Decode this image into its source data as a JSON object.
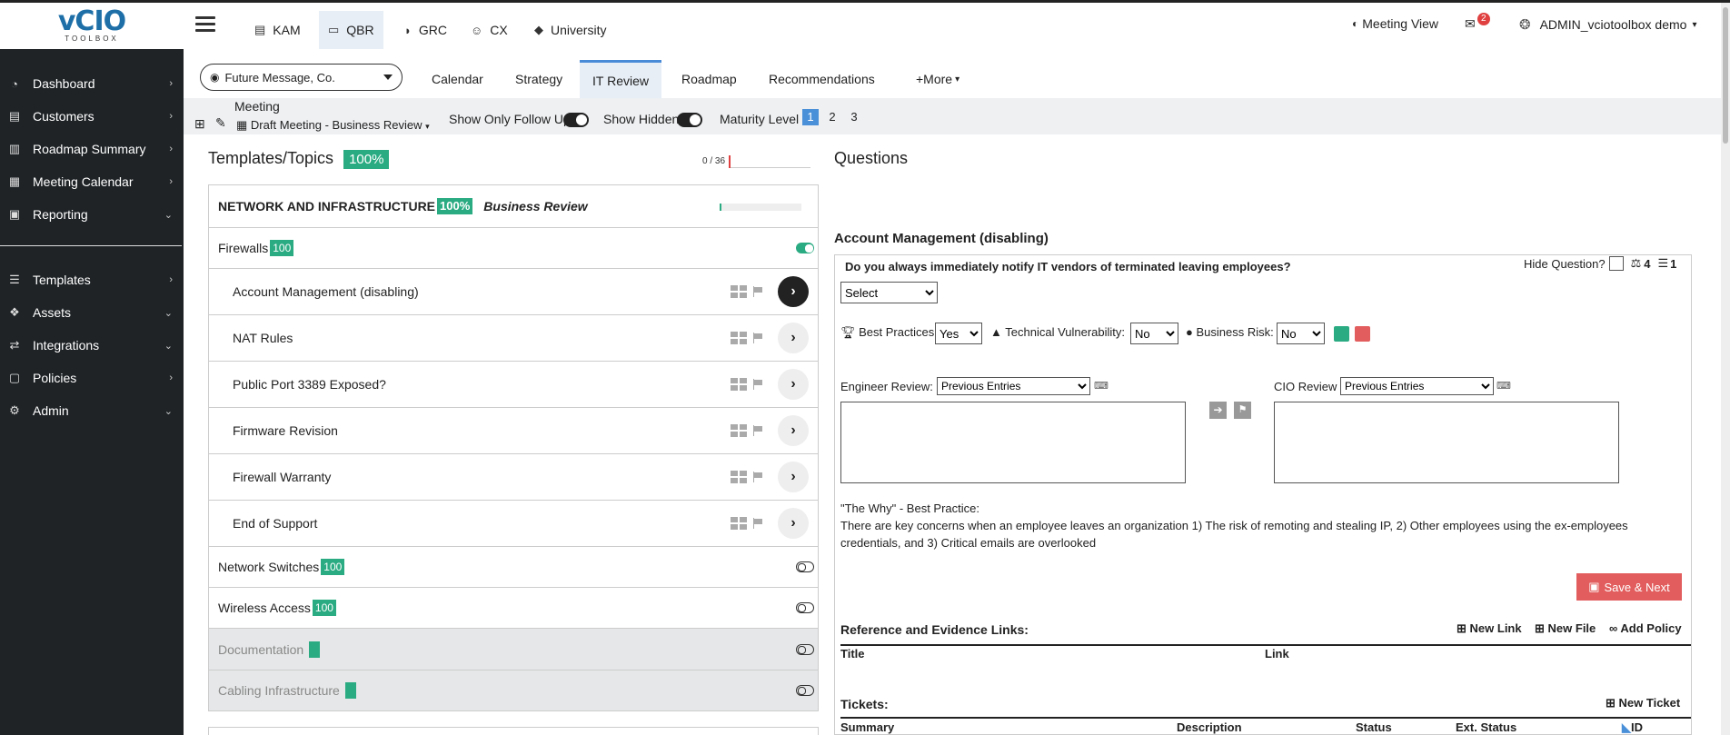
{
  "logo": {
    "main": "vCIO",
    "sub": "TOOLBOX"
  },
  "sidebar": {
    "items": [
      {
        "label": "Dashboard",
        "icon": "gauge-icon",
        "chevron": "›"
      },
      {
        "label": "Customers",
        "icon": "id-card-icon",
        "chevron": "›"
      },
      {
        "label": "Roadmap Summary",
        "icon": "map-icon",
        "chevron": "›"
      },
      {
        "label": "Meeting Calendar",
        "icon": "calendar-icon",
        "chevron": "›"
      },
      {
        "label": "Reporting",
        "icon": "report-icon",
        "chevron": "⌄"
      },
      {
        "label": "Templates",
        "icon": "list-icon",
        "chevron": "›"
      },
      {
        "label": "Assets",
        "icon": "cubes-icon",
        "chevron": "⌄"
      },
      {
        "label": "Integrations",
        "icon": "shuffle-icon",
        "chevron": "⌄"
      },
      {
        "label": "Policies",
        "icon": "document-icon",
        "chevron": "›"
      },
      {
        "label": "Admin",
        "icon": "gears-icon",
        "chevron": "⌄"
      }
    ]
  },
  "topnav": {
    "tabs": [
      {
        "label": "KAM",
        "icon": "address-card-icon"
      },
      {
        "label": "QBR",
        "icon": "laptop-icon"
      },
      {
        "label": "GRC",
        "icon": "shield-icon"
      },
      {
        "label": "CX",
        "icon": "smile-icon"
      },
      {
        "label": "University",
        "icon": "graduation-cap-icon"
      }
    ],
    "meeting_view": "Meeting View",
    "mail_count": "2",
    "user": "ADMIN_vciotoolbox demo"
  },
  "company": {
    "selected": "Future Message, Co."
  },
  "subtabs": [
    "Calendar",
    "Strategy",
    "IT Review",
    "Roadmap",
    "Recommendations",
    "+More"
  ],
  "meeting": {
    "label": "Meeting",
    "draft": "Draft Meeting - Business Review",
    "show_follow_up": "Show Only Follow Up",
    "show_hidden": "Show Hidden",
    "maturity_label": "Maturity Level",
    "levels": [
      "1",
      "2",
      "3"
    ]
  },
  "left": {
    "title": "Templates/Topics",
    "title_pct": "100%",
    "progress_text": "0 / 36",
    "progress_fraction": 0.0,
    "section": {
      "name": "NETWORK AND INFRASTRUCTURE",
      "pct": "100%",
      "type": "Business Review"
    },
    "firewalls": {
      "name": "Firewalls",
      "score": "100"
    },
    "topics": [
      "Account Management (disabling)",
      "NAT Rules",
      "Public Port 3389 Exposed?",
      "Firmware Revision",
      "Firewall Warranty",
      "End of Support"
    ],
    "categories": [
      {
        "name": "Network Switches",
        "score": "100"
      },
      {
        "name": "Wireless Access",
        "score": "100"
      },
      {
        "name": "Documentation",
        "score": ""
      },
      {
        "name": "Cabling Infrastructure",
        "score": ""
      }
    ]
  },
  "right": {
    "title": "Questions",
    "section": "Account Management (disabling)",
    "question": "Do you always immediately notify IT vendors of terminated leaving employees?",
    "hide_question": "Hide Question?",
    "weight": "4",
    "list_count": "1",
    "answer": "Select",
    "best_practices": {
      "label": "Best Practices:",
      "value": "Yes"
    },
    "tech_vuln": {
      "label": "Technical Vulnerability:",
      "value": "No"
    },
    "biz_risk": {
      "label": "Business Risk:",
      "value": "No"
    },
    "engineer_review": {
      "label": "Engineer Review:",
      "value": "Previous Entries"
    },
    "cio_review": {
      "label": "CIO Review",
      "value": "Previous Entries"
    },
    "why_title": "\"The Why\" - Best Practice:",
    "why_text": "There are key concerns when an employee leaves an organization 1) The risk of remoting and stealing IP, 2) Other employees using the ex-employees credentials, and 3) Critical emails are overlooked",
    "save_next": "Save & Next",
    "refs_title": "Reference and Evidence Links:",
    "new_link": "New Link",
    "new_file": "New File",
    "add_policy": "Add Policy",
    "col_title": "Title",
    "col_link": "Link",
    "tickets_title": "Tickets:",
    "new_ticket": "New Ticket",
    "tcol_summary": "Summary",
    "tcol_description": "Description",
    "tcol_status": "Status",
    "tcol_ext_status": "Ext. Status",
    "tcol_id": "ID"
  },
  "colors": {
    "accent": "#2bab82",
    "sidebar": "#1f2326",
    "danger": "#e25d5d",
    "primary": "#4a90d9"
  }
}
